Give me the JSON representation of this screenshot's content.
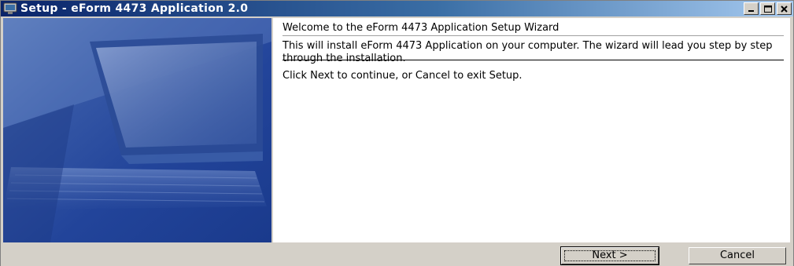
{
  "window": {
    "title": "Setup - eForm 4473 Application 2.0",
    "colors": {
      "title_gradient_start": "#0a246a",
      "title_gradient_end": "#a6caf0",
      "chrome": "#d4d0c8",
      "banner_blue": "#2a4c9e"
    }
  },
  "title_controls": {
    "minimize_icon": "minimize-icon",
    "maximize_icon": "maximize-icon",
    "close_icon": "close-icon"
  },
  "content": {
    "heading": "Welcome to the eForm 4473 Application Setup Wizard",
    "intro": "This will install eForm 4473 Application on your computer. The wizard will lead you step by step through the installation.",
    "instruction": "Click Next to continue, or Cancel to exit Setup."
  },
  "buttons": {
    "next_label": "Next >",
    "cancel_label": "Cancel"
  }
}
